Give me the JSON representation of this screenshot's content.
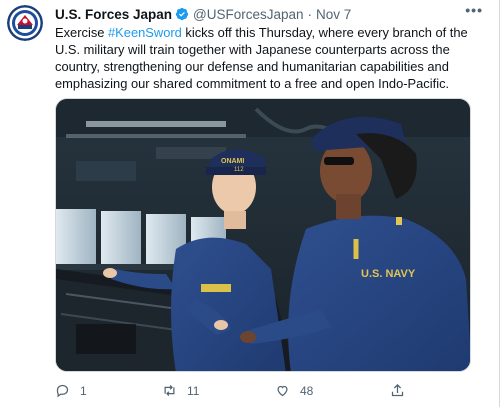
{
  "tweet": {
    "author_name": "U.S. Forces Japan",
    "author_handle": "@USForcesJapan",
    "separator": "·",
    "date": "Nov 7",
    "more_label": "•••",
    "text_before": "Exercise ",
    "hashtag": "#KeenSword",
    "text_after": " kicks off this Thursday, where every branch of the U.S. military will train together with Japanese counterparts across the country, strengthening our defense and humanitarian capabilities and emphasizing our shared commitment to a free and open Indo-Pacific.",
    "media": {
      "cap_text": "ONAMI",
      "cap_number": "112",
      "shirt_text": "U.S. NAVY",
      "name_tape": "ONAMI 112"
    }
  },
  "actions": {
    "reply_count": "1",
    "retweet_count": "11",
    "like_count": "48"
  },
  "colors": {
    "accent": "#1d9bf0",
    "text": "#0f1419",
    "muted": "#536471"
  },
  "icons": {
    "avatar": "usfj-seal-icon",
    "verified": "verified-badge-icon",
    "reply": "reply-icon",
    "retweet": "retweet-icon",
    "like": "heart-icon",
    "share": "share-icon"
  }
}
